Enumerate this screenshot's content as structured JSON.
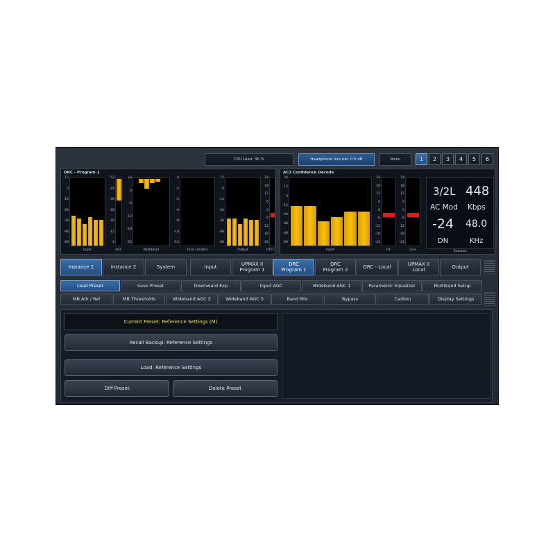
{
  "topbar": {
    "cpu_load": "CPU Load: 36 %",
    "headphone_volume": "Headphone Volume: 0.0 dB",
    "menu": "Menu",
    "numbers": [
      "1",
      "2",
      "3",
      "4",
      "5",
      "6"
    ],
    "active_number": "1"
  },
  "drc_panel": {
    "title": "DRC - Program 1",
    "scales": {
      "input": [
        "12",
        "0",
        "-12",
        "-24",
        "-36",
        "-48",
        "-60"
      ],
      "agc": [
        "-52",
        "-44",
        "-36",
        "-28",
        "-20",
        "-12",
        "-4"
      ],
      "multiband": [
        "+6",
        "0",
        "-6",
        "-12",
        "-18",
        "-24"
      ],
      "final_limiters": [
        "0",
        "-2",
        "-4",
        "-6",
        "-8",
        "-10",
        "-12"
      ],
      "output": [
        "12",
        "0",
        "-12",
        "-24",
        "-36",
        "-48",
        "-60"
      ],
      "dtfc": [
        "24",
        "18",
        "12",
        "6",
        "0",
        "-6",
        "-12",
        "-18",
        "-24"
      ]
    },
    "labels": {
      "input": "Input",
      "agc": "AGC",
      "multiband": "Multiband",
      "final_limiters": "Final Limiters",
      "output": "Output",
      "dtfc": "DTFC"
    },
    "levels": {
      "input_bars": [
        0.44,
        0.4,
        0.32,
        0.42,
        0.38,
        0.38
      ],
      "agc_bar": 0.32,
      "multiband_bars": [
        0.06,
        0.14,
        0.06,
        0.04
      ],
      "output_bars": [
        0.4,
        0.4,
        0.32,
        0.4,
        0.38,
        0.38
      ],
      "dtfc_level": 0.55
    }
  },
  "ac3_panel": {
    "title": "AC3 Confidence Decode",
    "scales": {
      "input": [
        "24",
        "12",
        "0",
        "-12",
        "-24",
        "-36",
        "-48",
        "-60"
      ],
      "fir": [
        "24",
        "18",
        "12",
        "6",
        "0",
        "-6",
        "-12",
        "-18",
        "-24"
      ],
      "line": [
        "24",
        "18",
        "12",
        "6",
        "0",
        "-6",
        "-12",
        "-18",
        "-24"
      ]
    },
    "labels": {
      "input": "Input",
      "fir": "FIF",
      "line": "Line",
      "readout": "Readout"
    },
    "levels": {
      "input_bars": [
        0.58,
        0.58,
        0.36,
        0.42,
        0.5,
        0.5
      ],
      "fir_level": 0.55,
      "line_level": 0.55
    },
    "readout": {
      "channels": "3/2L",
      "bitrate": "448",
      "mode": "AC Mod",
      "unit": "Kbps",
      "dialnorm": "-24",
      "sample_rate": "48.0",
      "dn_label": "DN",
      "rate_unit": "KHz"
    }
  },
  "instances": {
    "items": [
      "Instance 1",
      "Instance 2",
      "System"
    ],
    "active": "Instance 1"
  },
  "signal_path": {
    "items": [
      {
        "line1": "Input",
        "line2": ""
      },
      {
        "line1": "UPMAX II",
        "line2": "Program 1"
      },
      {
        "line1": "DRC",
        "line2": "Program 1"
      },
      {
        "line1": "DRC",
        "line2": "Program 2"
      },
      {
        "line1": "DRC - Local",
        "line2": ""
      },
      {
        "line1": "UPMAX II",
        "line2": "Local"
      },
      {
        "line1": "Output",
        "line2": ""
      }
    ],
    "active_index": 2
  },
  "tabs": {
    "row1": [
      "Load Preset",
      "Save Preset",
      "Downward Exp",
      "Input AGC",
      "Wideband AGC 1",
      "Parametric Equalizer",
      "Multiband Setup"
    ],
    "row2": [
      "MB Atk / Rel",
      "MB Thresholds",
      "Wideband AGC 2",
      "Wideband AGC 3",
      "Band Mix",
      "Bypass",
      "Carbon",
      "Display Settings"
    ],
    "active": "Load Preset"
  },
  "preset": {
    "current": "Current Preset: Reference Settings (M)",
    "recall_backup": "Recall Backup: Reference Settings",
    "load": "Load: Reference Settings",
    "diff": "Diff Preset",
    "delete": "Delete Preset"
  },
  "colors": {
    "meter_yellow": "#f6c20c",
    "peak_red": "#e21a1a",
    "active_blue": "#2d5d92",
    "current_preset_text": "#f2e14a"
  }
}
